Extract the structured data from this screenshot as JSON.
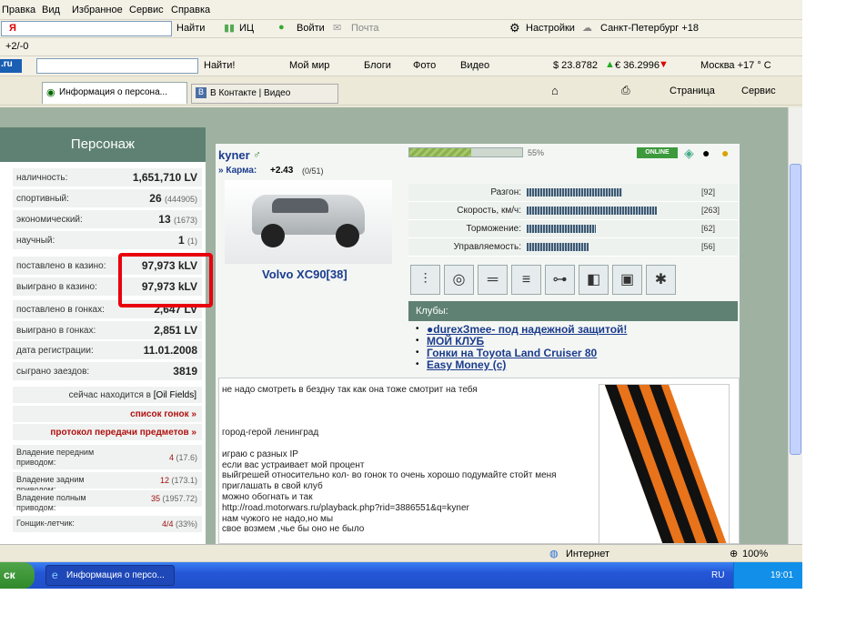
{
  "menu": [
    "Правка",
    "Вид",
    "Избранное",
    "Сервис",
    "Справка"
  ],
  "toolbar1": {
    "search_value": "Я",
    "go": "Найти",
    "ic": "ИЦ",
    "login": "Войти",
    "mail": "Почта",
    "settings": "Настройки",
    "weather": "Санкт-Петербург +18"
  },
  "toolbar2": {
    "score": "+2/-0"
  },
  "toolbar3": {
    "logo": ".ru",
    "go": "Найти!",
    "myworld": "Мой мир",
    "blogs": "Блоги",
    "photo": "Фото",
    "video": "Видео",
    "usd": "$ 23.8782",
    "eur": "€ 36.2996",
    "weather": "Москва +17 ° С"
  },
  "tabs": [
    {
      "label": "Информация о персона..."
    },
    {
      "label": "В Контакте | Видео"
    }
  ],
  "ie_toolbar": {
    "page": "Страница",
    "service": "Сервис"
  },
  "sidebar": {
    "title": "Персонаж",
    "stats": [
      {
        "k": "наличность:",
        "v": "1,651,710 LV",
        "s": ""
      },
      {
        "k": "спортивный:",
        "v": "26",
        "s": "(444905)"
      },
      {
        "k": "экономический:",
        "v": "13",
        "s": "(1673)"
      },
      {
        "k": "научный:",
        "v": "1",
        "s": "(1)"
      },
      {
        "k": "поставлено в казино:",
        "v": "97,973 kLV",
        "s": ""
      },
      {
        "k": "выиграно в казино:",
        "v": "97,973 kLV",
        "s": ""
      },
      {
        "k": "поставлено в гонках:",
        "v": "2,647 LV",
        "s": ""
      },
      {
        "k": "выиграно в гонках:",
        "v": "2,851 LV",
        "s": ""
      },
      {
        "k": "дата регистрации:",
        "v": "11.01.2008",
        "s": ""
      },
      {
        "k": "сыграно заездов:",
        "v": "3819",
        "s": ""
      }
    ],
    "location_prefix": "сейчас находится в",
    "location": "[Oil Fields]",
    "races_link": "список гонок »",
    "protocol_link": "протокол передачи предметов »",
    "drives": [
      {
        "k": "Владение передним приводом:",
        "v": "4",
        "s": "(17.6)"
      },
      {
        "k": "Владение задним приводом:",
        "v": "12",
        "s": "(173.1)"
      },
      {
        "k": "Владение полным приводом:",
        "v": "35",
        "s": "(1957.72)"
      },
      {
        "k": "Гонщик-летчик:",
        "v": "4/4",
        "s": "(33%)"
      }
    ]
  },
  "profile": {
    "name": "kyner",
    "gender": "♂",
    "karma_label": "» Карма:",
    "karma": "+2.43",
    "karma_votes": "(0/51)",
    "progress": 0.55,
    "progress_text": "55%",
    "online": "ONLINE",
    "car": "Volvo XC90[38]"
  },
  "car_stats": [
    {
      "k": "Разгон:",
      "n": "[92]",
      "frac": 0.55
    },
    {
      "k": "Скорость, км/ч:",
      "n": "[263]",
      "frac": 0.75
    },
    {
      "k": "Торможение:",
      "n": "[62]",
      "frac": 0.4
    },
    {
      "k": "Управляемость:",
      "n": "[56]",
      "frac": 0.36
    }
  ],
  "parts_icons": [
    "coilover-icon",
    "tire-icon",
    "exhaust-icon",
    "intake-icon",
    "camshaft-icon",
    "brake-icon",
    "engine-block-icon",
    "turbo-icon"
  ],
  "clubs": {
    "title": "Клубы:",
    "items": [
      "●durexЗmeе- под надежной защитой!",
      "МОЙ КЛУБ",
      "Гонки на Toyota Land Cruiser 80",
      "Easy Money (c)"
    ]
  },
  "about": [
    "не надо смотреть в бездну так как она тоже смотрит на тебя",
    "",
    "",
    "",
    "город-герой ленинград",
    "",
    "играю с разных IP",
    "если вас устраивает мой процент",
    "выйгрешей относительно кол- во гонок то очень хорошо подумайте стойт меня",
    "приглашать в свой клуб",
    "можно обогнать и так",
    "http://road.motorwars.ru/playback.php?rid=3886551&q=kyner",
    "нам чужого не надо,но мы",
    "свое возмем ,чье бы оно не было"
  ],
  "statusbar": {
    "zone": "Интернет",
    "zoom": "100%"
  },
  "taskbar": {
    "start": "ск",
    "task": "Информация о персо...",
    "lang": "RU",
    "clock": "19:01"
  },
  "colors": {
    "highlight": "#e8000c",
    "header": "#5f8173",
    "link": "#1a3c8c"
  }
}
